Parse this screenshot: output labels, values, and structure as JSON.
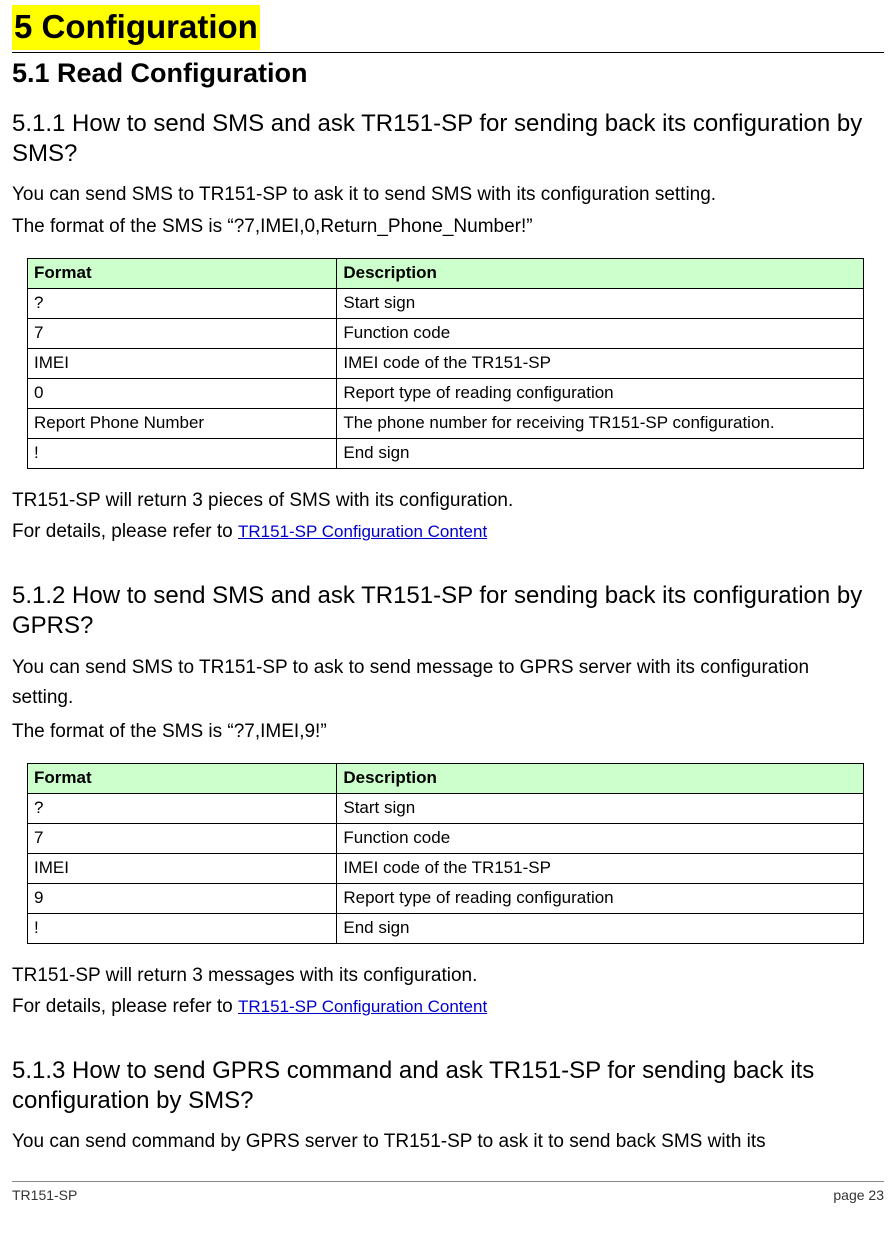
{
  "h1": "5 Configuration",
  "h2": "5.1 Read Configuration",
  "sec1": {
    "title": "5.1.1 How to send SMS and ask TR151-SP for sending back its configuration by SMS?",
    "p1": "You can send SMS to TR151-SP to ask it to send SMS with its configuration setting.",
    "p2": "The format of the SMS is “?7,IMEI,0,Return_Phone_Number!”",
    "th1": "Format",
    "th2": "Description",
    "rows": [
      {
        "f": "?",
        "d": "Start sign"
      },
      {
        "f": "7",
        "d": "Function code"
      },
      {
        "f": "IMEI",
        "d": "IMEI code of the TR151-SP"
      },
      {
        "f": "0",
        "d": "Report type of reading configuration"
      },
      {
        "f": "Report Phone Number",
        "d": "The phone number for receiving TR151-SP configuration."
      },
      {
        "f": "!",
        "d": "End sign"
      }
    ],
    "after1": "TR151-SP will return 3 pieces of SMS with its configuration.",
    "after2_pre": "For details, please refer to ",
    "after2_link": "TR151-SP Configuration Content"
  },
  "sec2": {
    "title": "5.1.2 How to send SMS and ask TR151-SP for sending back its configuration by GPRS?",
    "p1a": "You can send SMS to TR151-SP to ask to send message to GPRS server with its configuration",
    "p1b": "setting.",
    "p2": "The format of the SMS is “?7,IMEI,9!”",
    "th1": "Format",
    "th2": "Description",
    "rows": [
      {
        "f": "?",
        "d": "Start sign"
      },
      {
        "f": "7",
        "d": "Function code"
      },
      {
        "f": "IMEI",
        "d": "IMEI code of the TR151-SP"
      },
      {
        "f": "9",
        "d": "Report type of reading configuration"
      },
      {
        "f": "!",
        "d": "End sign"
      }
    ],
    "after1": "TR151-SP will return 3 messages with its configuration.",
    "after2_pre": "For details, please refer to ",
    "after2_link": "TR151-SP Configuration Content"
  },
  "sec3": {
    "title": "5.1.3 How to send GPRS command and ask TR151-SP for sending back its configuration by SMS?",
    "p1": "You can send command by GPRS server to TR151-SP to ask it to send back SMS with its"
  },
  "footer": {
    "left": "TR151-SP",
    "right": "page 23"
  }
}
